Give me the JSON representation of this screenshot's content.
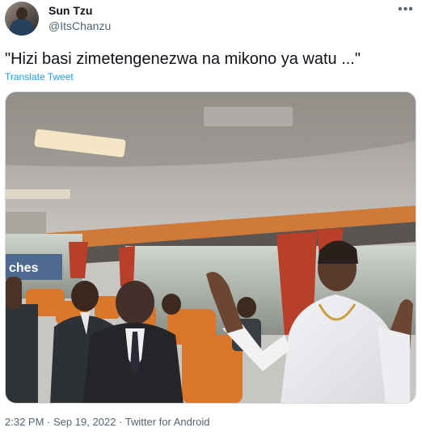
{
  "author": {
    "name": "Sun Tzu",
    "handle": "@ItsChanzu"
  },
  "tweet": {
    "text": "\"Hizi basi zimetengenezwa na mikono ya watu ...\"",
    "translate_label": "Translate Tweet"
  },
  "media": {
    "sign_text": "ches"
  },
  "meta": {
    "time": "2:32 PM",
    "separator": "·",
    "date": "Sep 19, 2022",
    "source": "Twitter for Android"
  },
  "colors": {
    "link": "#1d9bf0",
    "secondary_text": "#536471",
    "seat_orange": "#d9762a",
    "curtain_red": "#b8402a"
  },
  "icons": {
    "more": "more-horizontal-icon"
  }
}
